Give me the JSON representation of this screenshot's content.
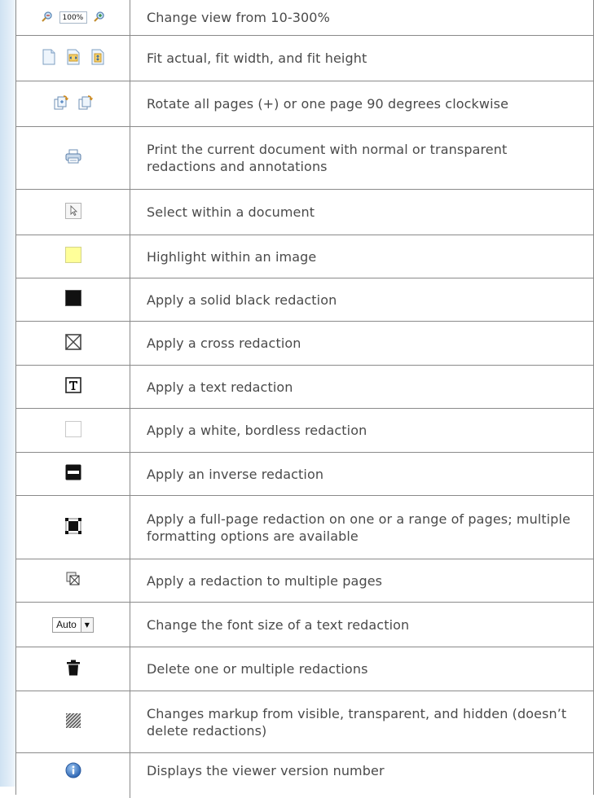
{
  "rows": [
    {
      "icon": "zoom-control",
      "zoom_value": "100%",
      "text": "Change view from 10-300%"
    },
    {
      "icon": "fit-buttons",
      "text": "Fit actual, fit width, and fit height"
    },
    {
      "icon": "rotate-buttons",
      "text": "Rotate all pages (+) or one page 90 degrees clockwise"
    },
    {
      "icon": "print-icon",
      "text": "Print the current document with normal or transparent redactions and annotations"
    },
    {
      "icon": "select-arrow-icon",
      "text": "Select within a document"
    },
    {
      "icon": "highlight-icon",
      "text": "Highlight within an image"
    },
    {
      "icon": "solid-black-redaction-icon",
      "text": "Apply a solid black redaction"
    },
    {
      "icon": "cross-redaction-icon",
      "text": "Apply a cross redaction"
    },
    {
      "icon": "text-redaction-icon",
      "text": "Apply a text redaction"
    },
    {
      "icon": "white-redaction-icon",
      "text": "Apply a white, bordless redaction"
    },
    {
      "icon": "inverse-redaction-icon",
      "text": "Apply an inverse redaction"
    },
    {
      "icon": "full-page-redaction-icon",
      "text": "Apply a full-page redaction on one or a range of pages; multiple formatting options are available"
    },
    {
      "icon": "multi-page-redaction-icon",
      "text": "Apply a redaction to multiple pages"
    },
    {
      "icon": "font-size-dropdown",
      "dropdown_value": "Auto",
      "text": "Change the font size of a text redaction"
    },
    {
      "icon": "trash-icon",
      "text": "Delete one or multiple redactions"
    },
    {
      "icon": "markup-visibility-icon",
      "text": "Changes markup from visible, transparent, and hidden (doesn’t delete redactions)"
    },
    {
      "icon": "info-icon",
      "text": "Displays the viewer version number"
    }
  ],
  "colors": {
    "border": "#8a8a8a",
    "text": "#4a4a4a",
    "highlight": "#ffff99",
    "info_blue": "#3a78c8"
  }
}
